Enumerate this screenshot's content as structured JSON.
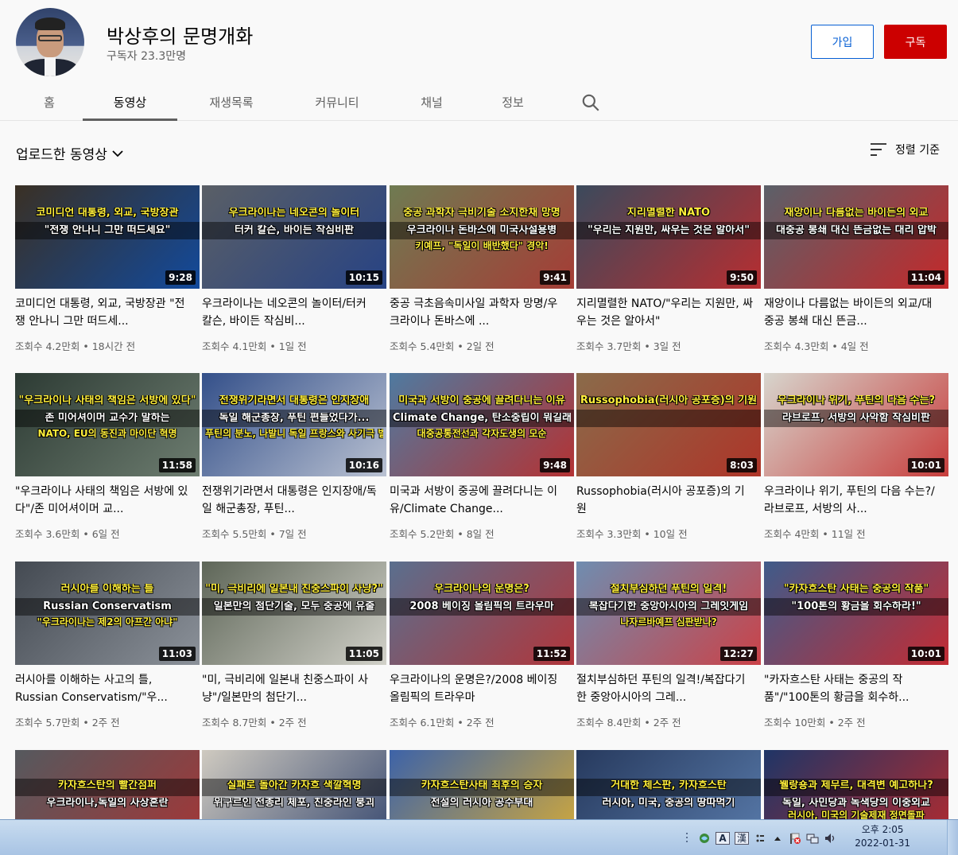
{
  "channel": {
    "name": "박상후의 문명개화",
    "subscribers": "구독자 23.3만명",
    "join_label": "가입",
    "subscribe_label": "구독"
  },
  "tabs": [
    {
      "label": "홈"
    },
    {
      "label": "동영상"
    },
    {
      "label": "재생목록"
    },
    {
      "label": "커뮤니티"
    },
    {
      "label": "채널"
    },
    {
      "label": "정보"
    }
  ],
  "section": {
    "uploads_label": "업로드한 동영상",
    "sort_label": "정렬 기준"
  },
  "videos": [
    {
      "duration": "9:28",
      "title": "코미디언 대통령, 외교, 국방장관 \"전쟁 안나니 그만 떠드세...",
      "views": "조회수 4.2만회",
      "age": "18시간 전",
      "thumb_l1": "코미디언 대통령, 외교, 국방장관",
      "thumb_l2": "\"전쟁 안나니 그만 떠드세요\"",
      "thumb_l3": "",
      "bg": "#3a3024",
      "accent": "#0a4fb4"
    },
    {
      "duration": "10:15",
      "title": "우크라이나는 네오콘의 놀이터/터커 칼슨, 바이든 작심비...",
      "views": "조회수 4.1만회",
      "age": "1일 전",
      "thumb_l1": "우크라이나는 네오콘의 놀이터",
      "thumb_l2": "터커 칼슨, 바이든 작심비판",
      "thumb_l3": "",
      "bg": "#5a5f66",
      "accent": "#1d3d8a"
    },
    {
      "duration": "9:41",
      "title": "중공 극초음속미사일 과학자 망명/우크라이나 돈바스에 ...",
      "views": "조회수 5.4만회",
      "age": "2일 전",
      "thumb_l1": "중공 과학자 극비기술 소지한채 망명",
      "thumb_l2": "우크라이나 돈바스에 미국사설용병",
      "thumb_l3": "키예프, \"독일이 배반했다\" 경악!",
      "bg": "#6f7b52",
      "accent": "#b03030"
    },
    {
      "duration": "9:50",
      "title": "지리멸렬한 NATO/\"우리는 지원만, 싸우는 것은 알아서\"",
      "views": "조회수 3.7만회",
      "age": "3일 전",
      "thumb_l1": "지리멸렬한 NATO",
      "thumb_l2": "\"우리는 지원만, 싸우는 것은 알아서\"",
      "thumb_l3": "",
      "bg": "#3b4a5c",
      "accent": "#d02828"
    },
    {
      "duration": "11:04",
      "title": "재앙이나 다름없는 바이든의 외교/대중공 봉쇄 대신 뜬금...",
      "views": "조회수 4.3만회",
      "age": "4일 전",
      "thumb_l1": "재앙이나 다름없는 바이든의 외교",
      "thumb_l2": "대중공 봉쇄 대신 뜬금없는 대리 압박",
      "thumb_l3": "",
      "bg": "#5b6069",
      "accent": "#d81e1e"
    },
    {
      "duration": "11:58",
      "title": "\"우크라이나 사태의 책임은 서방에 있다\"/존 미어셔이머 교...",
      "views": "조회수 3.6만회",
      "age": "6일 전",
      "thumb_l1": "\"우크라이나 사태의 책임은 서방에 있다\"",
      "thumb_l2": "존 미어셔이머 교수가 말하는",
      "thumb_l3": "NATO, EU의 동진과 마이단 혁명",
      "bg": "#2d3b34",
      "accent": "#7a8a7c"
    },
    {
      "duration": "10:16",
      "title": "전쟁위기라면서 대통령은 인지장애/독일 해군총장, 푸틴...",
      "views": "조회수 5.5만회",
      "age": "7일 전",
      "thumb_l1": "전쟁위기라면서 대통령은 인지장애",
      "thumb_l2": "독일 해군총장, 푸틴 편들었다가...",
      "thumb_l3": "푸틴의 분노, 나발니 독일 프랑스와 사기극 벌였다",
      "bg": "#34508a",
      "accent": "#d4d8e0"
    },
    {
      "duration": "9:48",
      "title": "미국과 서방이 중공에 끌려다니는 이유/Climate Change...",
      "views": "조회수 5.2만회",
      "age": "8일 전",
      "thumb_l1": "미국과 서방이 중공에 끌려다니는 이유",
      "thumb_l2": "Climate Change, 탄소중립이 뭐길래?",
      "thumb_l3": "대중공통전선과 각자도생의 모순",
      "bg": "#4f7aa0",
      "accent": "#c8241e"
    },
    {
      "duration": "8:03",
      "title": "Russophobia(러시아 공포증)의 기원",
      "views": "조회수 3.3만회",
      "age": "10일 전",
      "thumb_l1": "Russophobia(러시아 공포증)의 기원",
      "thumb_l2": "",
      "thumb_l3": "",
      "bg": "#8a6b4a",
      "accent": "#b52a22"
    },
    {
      "duration": "10:01",
      "title": "우크라이나 위기, 푸틴의 다음 수는?/라브로프, 서방의 사...",
      "views": "조회수 4만회",
      "age": "11일 전",
      "thumb_l1": "우크라이나 위기, 푸틴의 다음 수는?",
      "thumb_l2": "라브로프, 서방의 사악함 작심비판",
      "thumb_l3": "",
      "bg": "#d7d5cd",
      "accent": "#c42020"
    },
    {
      "duration": "11:03",
      "title": "러시아를 이해하는 사고의 틀, Russian Conservatism/\"우...",
      "views": "조회수 5.7만회",
      "age": "2주 전",
      "thumb_l1": "러시아를 이해하는 틀",
      "thumb_l2": "Russian Conservatism",
      "thumb_l3": "\"우크라이나는 제2의 아프간 아냐\"",
      "bg": "#444a52",
      "accent": "#9aa0a8"
    },
    {
      "duration": "11:05",
      "title": "\"미, 극비리에 일본내 친중스파이 사냥\"/일본만의 첨단기...",
      "views": "조회수 8.7만회",
      "age": "2주 전",
      "thumb_l1": "\"미, 극비리에 일본내 친중스파이 사냥?\"",
      "thumb_l2": "일본만의 첨단기술, 모두 중공에 유출",
      "thumb_l3": "",
      "bg": "#5e6658",
      "accent": "#e8e6df"
    },
    {
      "duration": "11:52",
      "title": "우크라이나의 운명은?/2008 베이징 올림픽의 트라우마",
      "views": "조회수 6.1만회",
      "age": "2주 전",
      "thumb_l1": "우크라이나의 운명은?",
      "thumb_l2": "2008 베이징 올림픽의 트라우마",
      "thumb_l3": "",
      "bg": "#5a6f8e",
      "accent": "#c22a2a"
    },
    {
      "duration": "12:27",
      "title": "절치부심하던 푸틴의 일격!/복잡다기한 중앙아시아의 그레...",
      "views": "조회수 8.4만회",
      "age": "2주 전",
      "thumb_l1": "절치부심하던 푸틴의 일격!",
      "thumb_l2": "복잡다기한 중앙아시아의 그레잇게임",
      "thumb_l3": "나자르바예프 심판받나?",
      "bg": "#6f8db0",
      "accent": "#d33"
    },
    {
      "duration": "10:01",
      "title": "\"카자흐스탄 사태는 중공의 작품\"/\"100톤의 황금을 회수하...",
      "views": "조회수 10만회",
      "age": "2주 전",
      "thumb_l1": "\"카자흐스탄 사태는 중공의 작품\"",
      "thumb_l2": "\"100톤의 황금을 회수하라!\"",
      "thumb_l3": "",
      "bg": "#3f5b8a",
      "accent": "#d22"
    },
    {
      "duration": "",
      "title": "",
      "views": "",
      "age": "",
      "thumb_l1": "카자흐스탄의 빨간점퍼",
      "thumb_l2": "우크라이나,독일의 사상혼란",
      "thumb_l3": "",
      "bg": "#55595e",
      "accent": "#a33"
    },
    {
      "duration": "",
      "title": "",
      "views": "",
      "age": "",
      "thumb_l1": "실패로 돌아간 카자흐 색깔혁명",
      "thumb_l2": "위구르인 전총리 체포, 친중라인 붕괴",
      "thumb_l3": "",
      "bg": "#cfcac0",
      "accent": "#2c3f6a"
    },
    {
      "duration": "",
      "title": "",
      "views": "",
      "age": "",
      "thumb_l1": "카자흐스탄사태 최후의 승자",
      "thumb_l2": "전설의 러시아 공수부대",
      "thumb_l3": "",
      "bg": "#3d63a8",
      "accent": "#e0b030"
    },
    {
      "duration": "",
      "title": "",
      "views": "",
      "age": "",
      "thumb_l1": "거대한 체스판, 카자흐스탄",
      "thumb_l2": "러시아, 미국, 중공의 땅따먹기",
      "thumb_l3": "",
      "bg": "#273a5e",
      "accent": "#5c7fb0"
    },
    {
      "duration": "",
      "title": "",
      "views": "",
      "age": "",
      "thumb_l1": "웰랑숑과 제무르, 대격변 예고하나?",
      "thumb_l2": "독일, 사민당과 녹색당의 이중외교",
      "thumb_l3": "러시아, 미국의 기술제재 정면돌파",
      "bg": "#1f3566",
      "accent": "#c02a2a"
    }
  ],
  "taskbar": {
    "time": "오후 2:05",
    "date": "2022-01-31",
    "ime_label": "A",
    "hanja_label": "漢"
  },
  "colors": {
    "subscribe_bg": "#cc0000",
    "join_border": "#065fd4",
    "background": "#f9f9f9"
  },
  "icons": [
    "search-icon",
    "chevron-down-icon",
    "sort-icon",
    "network-icon",
    "volume-icon",
    "flag-icon"
  ]
}
